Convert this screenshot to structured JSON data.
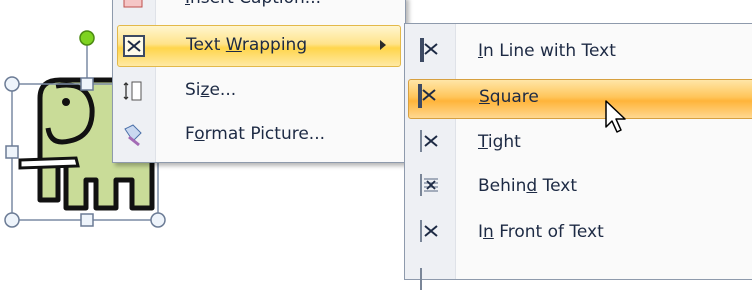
{
  "context_menu": {
    "items": [
      {
        "label": "Insert Caption...",
        "accel": "I",
        "rest": "nsert Caption...",
        "icon": "insert-caption-icon"
      },
      {
        "label": "Text Wrapping",
        "before": "Text ",
        "accel": "W",
        "rest": "rapping",
        "icon": "text-wrapping-icon",
        "has_submenu": true
      },
      {
        "label": "Size...",
        "before": "Si",
        "accel": "z",
        "rest": "e...",
        "icon": "size-icon"
      },
      {
        "label": "Format Picture...",
        "before": "F",
        "accel": "o",
        "rest": "rmat Picture...",
        "icon": "format-picture-icon"
      }
    ]
  },
  "submenu": {
    "items": [
      {
        "label": "In Line with Text",
        "accel": "I",
        "rest": "n Line with Text",
        "icon": "in-line-with-text-icon"
      },
      {
        "label": "Square",
        "accel": "S",
        "rest": "quare",
        "icon": "square-wrap-icon",
        "selected": true
      },
      {
        "label": "Tight",
        "accel": "T",
        "rest": "ight",
        "icon": "tight-wrap-icon"
      },
      {
        "label": "Behind Text",
        "before": "Behin",
        "accel": "d",
        "rest": " Text",
        "icon": "behind-text-icon"
      },
      {
        "label": "In Front of Text",
        "before": "I",
        "accel": "n",
        "rest": " Front of Text",
        "icon": "in-front-of-text-icon"
      }
    ]
  },
  "colors": {
    "highlight": "#ffe38a",
    "selected": "#ffc55a",
    "elephant": "#c9dc98",
    "rotate_handle": "#7ed321"
  }
}
